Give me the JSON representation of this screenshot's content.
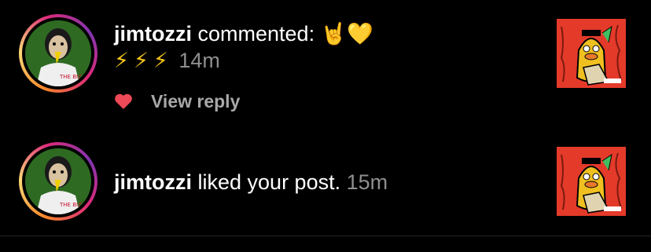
{
  "notifications": [
    {
      "username": "jimtozzi",
      "action": " commented: ",
      "emoji": "🤘💛",
      "comment": "⚡⚡⚡",
      "time": "14m",
      "reply_label": "View reply",
      "liked": true,
      "avatar_text": "THE BIZ"
    },
    {
      "username": "jimtozzi",
      "action": " liked your post. ",
      "time": "15m",
      "avatar_text": "THE BIZ"
    }
  ],
  "colors": {
    "heart": "#ed4956",
    "muted_text": "#8e8e8e",
    "thumb_bg": "#e43a2a",
    "ring_start": "#f58529",
    "ring_end": "#dd2a7b"
  }
}
